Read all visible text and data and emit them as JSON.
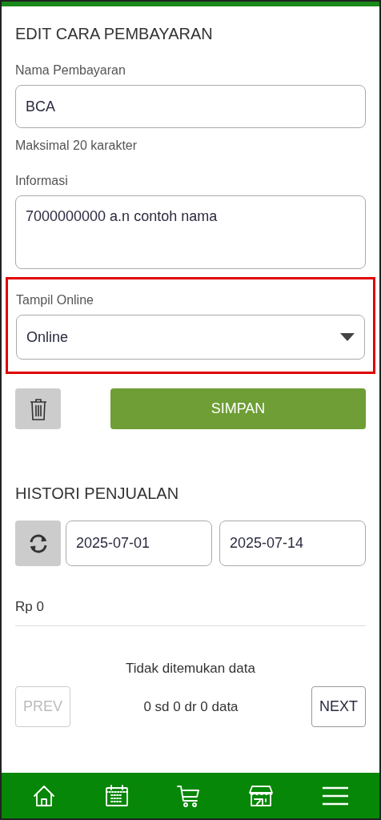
{
  "edit_section": {
    "title": "EDIT CARA PEMBAYARAN",
    "name_field": {
      "label": "Nama Pembayaran",
      "value": "BCA",
      "hint": "Maksimal 20 karakter"
    },
    "info_field": {
      "label": "Informasi",
      "value": "7000000000 a.n contoh nama"
    },
    "online_select": {
      "label": "Tampil Online",
      "value": "Online",
      "highlighted": true
    },
    "save_button": "SIMPAN"
  },
  "history_section": {
    "title": "HISTORI PENJUALAN",
    "date_from": "2025-07-01",
    "date_to": "2025-07-14",
    "total": "Rp 0",
    "empty_message": "Tidak ditemukan data",
    "pagination": {
      "prev": {
        "label": "PREV",
        "disabled": true
      },
      "summary": "0 sd 0 dr 0 data",
      "next": {
        "label": "NEXT",
        "disabled": false
      }
    }
  },
  "bottom_nav": [
    {
      "kind": "home"
    },
    {
      "kind": "calendar"
    },
    {
      "kind": "cart"
    },
    {
      "kind": "store"
    },
    {
      "kind": "menu"
    }
  ]
}
